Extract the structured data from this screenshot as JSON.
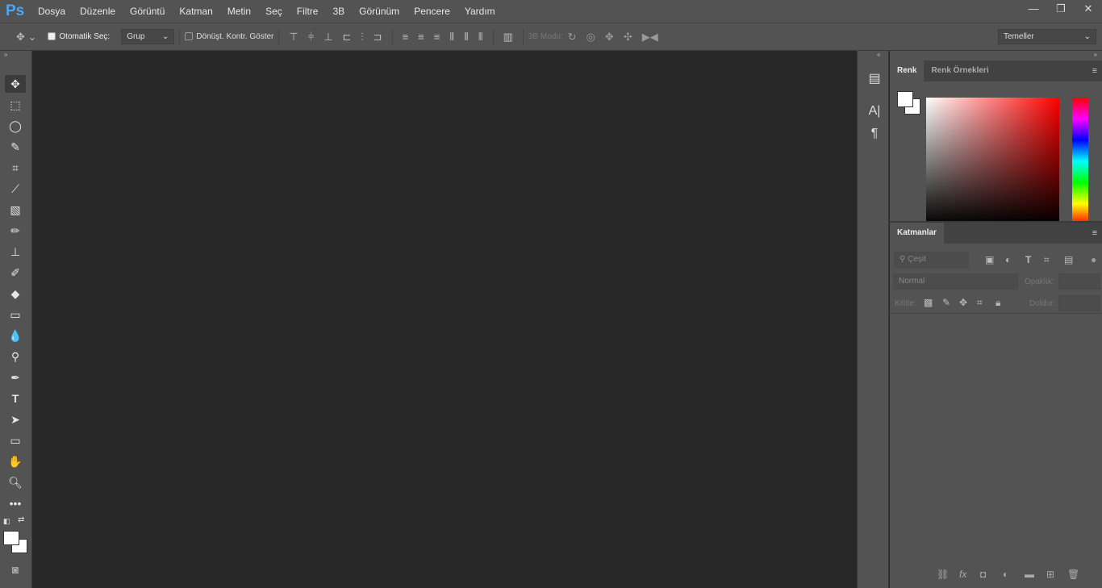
{
  "app": {
    "logo": "Ps"
  },
  "menu": [
    "Dosya",
    "Düzenle",
    "Görüntü",
    "Katman",
    "Metin",
    "Seç",
    "Filtre",
    "3B",
    "Görünüm",
    "Pencere",
    "Yardım"
  ],
  "window_controls": {
    "minimize": "—",
    "restore": "❐",
    "close": "✕"
  },
  "options": {
    "auto_select_label": "Otomatik Seç:",
    "auto_select_checked": true,
    "auto_select_value": "Grup",
    "transform_controls_label": "Dönüşt. Kontr. Göster",
    "transform_controls_checked": false,
    "mode_3d_label": "3B Modu:",
    "workspace": "Temeller"
  },
  "panels": {
    "color": {
      "tabs": [
        "Renk",
        "Renk Örnekleri"
      ],
      "foreground": "#ffffff",
      "background": "#ffffff",
      "hue": "#ff0000"
    },
    "layers": {
      "tab": "Katmanlar",
      "filter_placeholder": "Çeşit",
      "blend_mode": "Normal",
      "opacity_label": "Opaklık:",
      "lock_label": "Kilitle:",
      "fill_label": "Doldur:"
    }
  }
}
